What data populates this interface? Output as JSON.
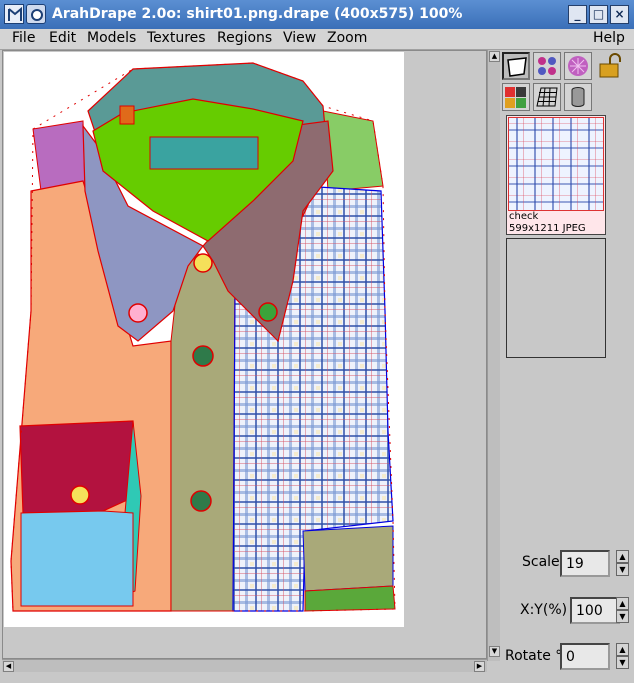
{
  "window": {
    "title": "ArahDrape 2.0o: shirt01.png.drape (400x575) 100%"
  },
  "menubar": {
    "items": [
      "File",
      "Edit",
      "Models",
      "Textures",
      "Regions",
      "View",
      "Zoom"
    ],
    "help": "Help"
  },
  "textures": {
    "selected": {
      "name": "check",
      "info": "599x1211 JPEG"
    }
  },
  "controls": {
    "scale": {
      "label": "Scale",
      "value": "19"
    },
    "ratio": {
      "label": "X:Y(%)",
      "value": "100"
    },
    "rotate": {
      "label": "Rotate °",
      "value": "0"
    }
  },
  "icons": {
    "tools": [
      "deform-tool-icon",
      "regions-tool-icon",
      "texture-tool-icon",
      "lock-icon",
      "masks-tool-icon",
      "grid-tool-icon",
      "cylinder-tool-icon"
    ]
  },
  "colors": {
    "titlebar": "#3a6fb8",
    "region_outline": "#e00000",
    "selected_region_outline": "#0000e0",
    "sleeve_left": "#f7a97a",
    "collar_front": "#66cc00",
    "collar_teal": "#5a9a96",
    "collar_right": "#8e6b70",
    "placket": "#a9a979",
    "pocket_flap": "#b3123f"
  }
}
